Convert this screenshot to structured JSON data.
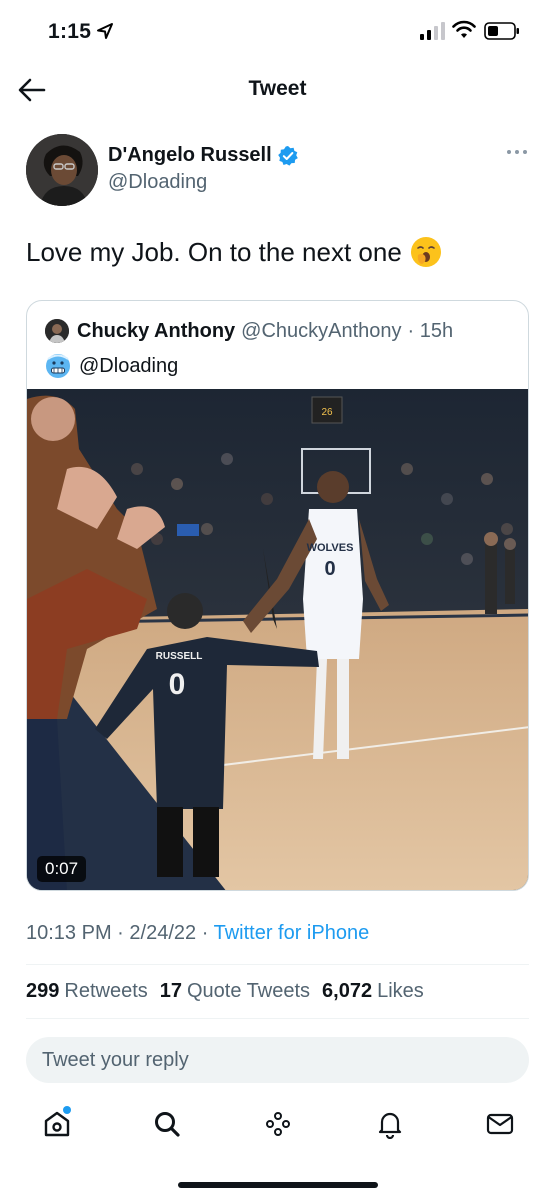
{
  "status_bar": {
    "time": "1:15"
  },
  "nav": {
    "title": "Tweet"
  },
  "author": {
    "name": "D'Angelo Russell",
    "handle": "@Dloading"
  },
  "tweet": {
    "text": "Love my Job. On to the next one"
  },
  "quote": {
    "name": "Chucky Anthony",
    "handle": "@ChuckyAnthony",
    "time": "· 15h",
    "mention": "@Dloading",
    "video_duration": "0:07"
  },
  "meta": {
    "time": "10:13 PM",
    "sep1": "·",
    "date": "2/24/22",
    "sep2": "·",
    "source": "Twitter for iPhone"
  },
  "stats": {
    "retweets_count": "299",
    "retweets_label": "Retweets",
    "quotes_count": "17",
    "quotes_label": "Quote Tweets",
    "likes_count": "6,072",
    "likes_label": "Likes"
  },
  "reply": {
    "placeholder": "Tweet your reply"
  },
  "tabs": [
    "home-icon",
    "search-icon",
    "spaces-icon",
    "notifications-icon",
    "messages-icon"
  ],
  "colors": {
    "accent": "#1d9bf0",
    "text": "#0f1419",
    "secondary": "#536471",
    "border": "#cfd9de"
  }
}
